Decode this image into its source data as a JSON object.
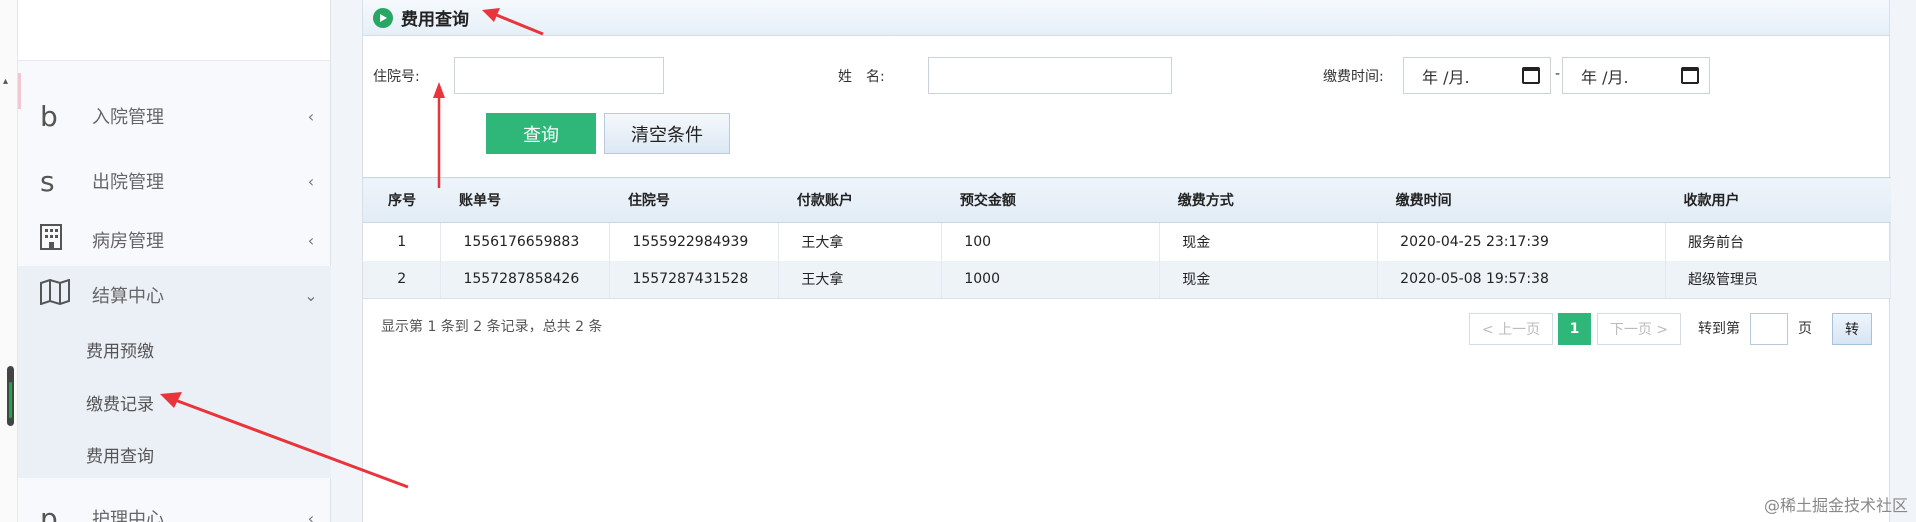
{
  "sidebar": {
    "items": [
      {
        "icon": "b",
        "label": "入院管理",
        "arrow": "‹"
      },
      {
        "icon": "s",
        "label": "出院管理",
        "arrow": "‹"
      },
      {
        "icon": "building-icon",
        "label": "病房管理",
        "arrow": "‹"
      },
      {
        "icon": "map-icon",
        "label": "结算中心",
        "arrow": "⌄"
      },
      {
        "icon": "p",
        "label": "护理中心",
        "arrow": "‹"
      }
    ],
    "sub_items": [
      "费用预缴",
      "缴费记录",
      "费用查询"
    ]
  },
  "panel": {
    "title": "费用查询"
  },
  "form": {
    "hospital_no_label": "住院号:",
    "name_label": "姓　名:",
    "pay_time_label": "缴费时间:",
    "date_start": "年 /月.",
    "date_end": "年 /月.",
    "dash": "-",
    "query_button": "查询",
    "clear_button": "清空条件"
  },
  "table": {
    "headers": [
      "序号",
      "账单号",
      "住院号",
      "付款账户",
      "预交金额",
      "缴费方式",
      "缴费时间",
      "收款用户"
    ],
    "rows": [
      [
        "1",
        "1556176659883",
        "1555922984939",
        "王大拿",
        "100",
        "现金",
        "2020-04-25 23:17:39",
        "服务前台"
      ],
      [
        "2",
        "1557287858426",
        "1557287431528",
        "王大拿",
        "1000",
        "现金",
        "2020-05-08 19:57:38",
        "超级管理员"
      ]
    ]
  },
  "pagination": {
    "summary": "显示第 1 条到 2 条记录，总共 2 条",
    "prev": "< 上一页",
    "current": "1",
    "next": "下一页 >",
    "goto_label": "转到第",
    "page_label": "页",
    "go_button": "转"
  },
  "watermark": "@稀土掘金技术社区",
  "colors": {
    "accent": "#2fb679",
    "arrow": "#e8343a"
  }
}
